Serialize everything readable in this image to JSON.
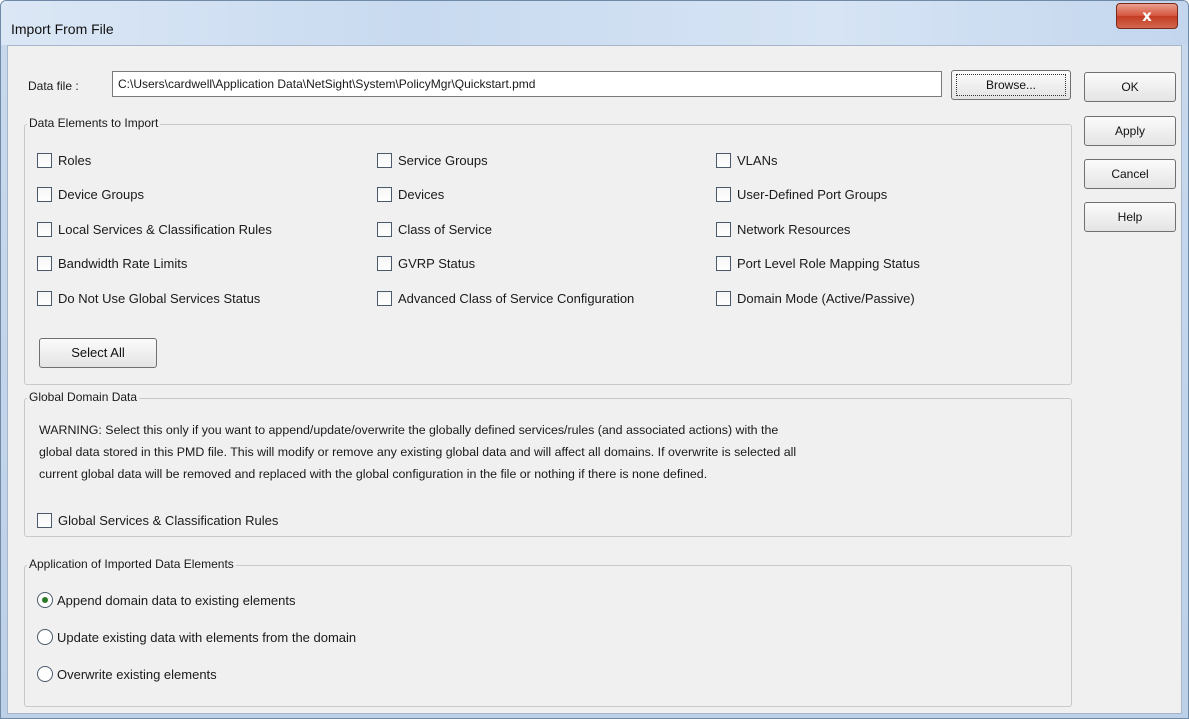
{
  "window": {
    "title": "Import From File",
    "close_label": "x"
  },
  "datafile": {
    "label": "Data file :",
    "value": "C:\\Users\\cardwell\\Application Data\\NetSight\\System\\PolicyMgr\\Quickstart.pmd",
    "browse_label": "Browse..."
  },
  "actions": {
    "ok": "OK",
    "apply": "Apply",
    "cancel": "Cancel",
    "help": "Help"
  },
  "elements_group": {
    "title": "Data Elements to Import",
    "items": [
      {
        "label": "Roles",
        "checked": false
      },
      {
        "label": "Service Groups",
        "checked": false
      },
      {
        "label": "VLANs",
        "checked": false
      },
      {
        "label": "Device Groups",
        "checked": false
      },
      {
        "label": "Devices",
        "checked": false
      },
      {
        "label": "User-Defined Port Groups",
        "checked": false
      },
      {
        "label": "Local Services & Classification Rules",
        "checked": false
      },
      {
        "label": "Class of Service",
        "checked": false
      },
      {
        "label": "Network Resources",
        "checked": false
      },
      {
        "label": "Bandwidth Rate Limits",
        "checked": false
      },
      {
        "label": "GVRP Status",
        "checked": false
      },
      {
        "label": "Port Level Role Mapping Status",
        "checked": false
      },
      {
        "label": "Do Not Use Global Services Status",
        "checked": false
      },
      {
        "label": "Advanced Class of Service Configuration",
        "checked": false
      },
      {
        "label": "Domain Mode (Active/Passive)",
        "checked": false
      }
    ],
    "select_all_label": "Select All"
  },
  "global_group": {
    "title": "Global Domain Data",
    "warning_lines": [
      "WARNING: Select this only if you want to append/update/overwrite the globally defined services/rules (and associated actions) with the",
      "global data stored in this PMD file. This will modify or remove any existing global data and will affect all domains.  If overwrite is selected all",
      "current global data will be removed and replaced with the global configuration in the file or nothing if there is none defined."
    ],
    "checkbox_label": "Global Services & Classification Rules",
    "checked": false
  },
  "application_group": {
    "title": "Application of Imported Data Elements",
    "options": [
      {
        "label": "Append domain data to existing elements",
        "selected": true
      },
      {
        "label": "Update existing data with elements from the domain",
        "selected": false
      },
      {
        "label": "Overwrite existing elements",
        "selected": false
      }
    ]
  }
}
